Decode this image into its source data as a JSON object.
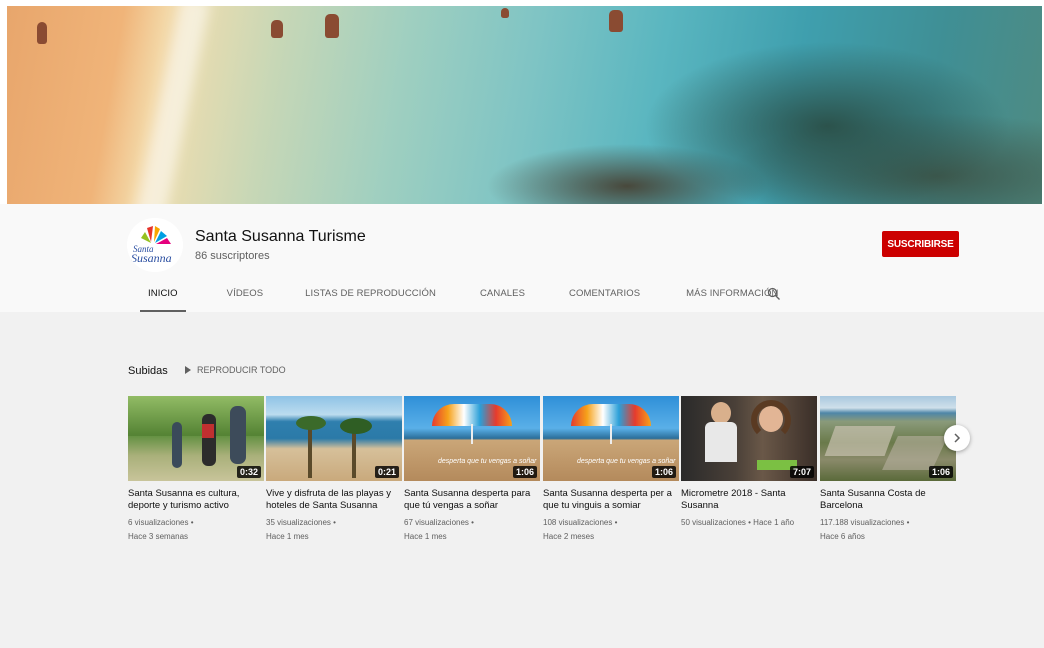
{
  "channel": {
    "name": "Santa Susanna Turisme",
    "subscribers": "86 suscriptores",
    "subscribe_label": "SUSCRIBIRSE",
    "avatar_text": "Santa Susanna"
  },
  "tabs": [
    {
      "label": "INICIO",
      "active": true
    },
    {
      "label": "VÍDEOS",
      "active": false
    },
    {
      "label": "LISTAS DE REPRODUCCIÓN",
      "active": false
    },
    {
      "label": "CANALES",
      "active": false
    },
    {
      "label": "COMENTARIOS",
      "active": false
    },
    {
      "label": "MÁS INFORMACIÓN",
      "active": false
    }
  ],
  "section": {
    "title": "Subidas",
    "play_all": "REPRODUCIR TODO"
  },
  "videos": [
    {
      "title": "Santa Susanna es cultura, deporte y turismo activo",
      "views": "6 visualizaciones •",
      "age": "Hace 3 semanas",
      "duration": "0:32"
    },
    {
      "title": "Vive y disfruta de las playas y hoteles de Santa Susanna",
      "views": "35 visualizaciones •",
      "age": "Hace 1 mes",
      "duration": "0:21"
    },
    {
      "title": "Santa Susanna desperta para que tú vengas a soñar",
      "views": "67 visualizaciones •",
      "age": "Hace 1 mes",
      "duration": "1:06"
    },
    {
      "title": "Santa Susanna desperta per a que tu vinguis a somiar",
      "views": "108 visualizaciones •",
      "age": "Hace 2 meses",
      "duration": "1:06"
    },
    {
      "title": "Micrometre 2018 - Santa Susanna",
      "views": "50 visualizaciones • Hace 1 año",
      "age": "",
      "duration": "7:07"
    },
    {
      "title": "Santa Susanna Costa de Barcelona",
      "views": "117.188 visualizaciones •",
      "age": "Hace 6 años",
      "duration": "1:06"
    }
  ],
  "thumb_text": "desperta que tu vengas a soñar",
  "icons": {
    "search": "search-icon",
    "next": "chevron-right-icon",
    "play": "play-icon"
  },
  "colors": {
    "subscribe": "#cc0000",
    "background": "#f1f1f1",
    "header": "#f9f9f9"
  }
}
